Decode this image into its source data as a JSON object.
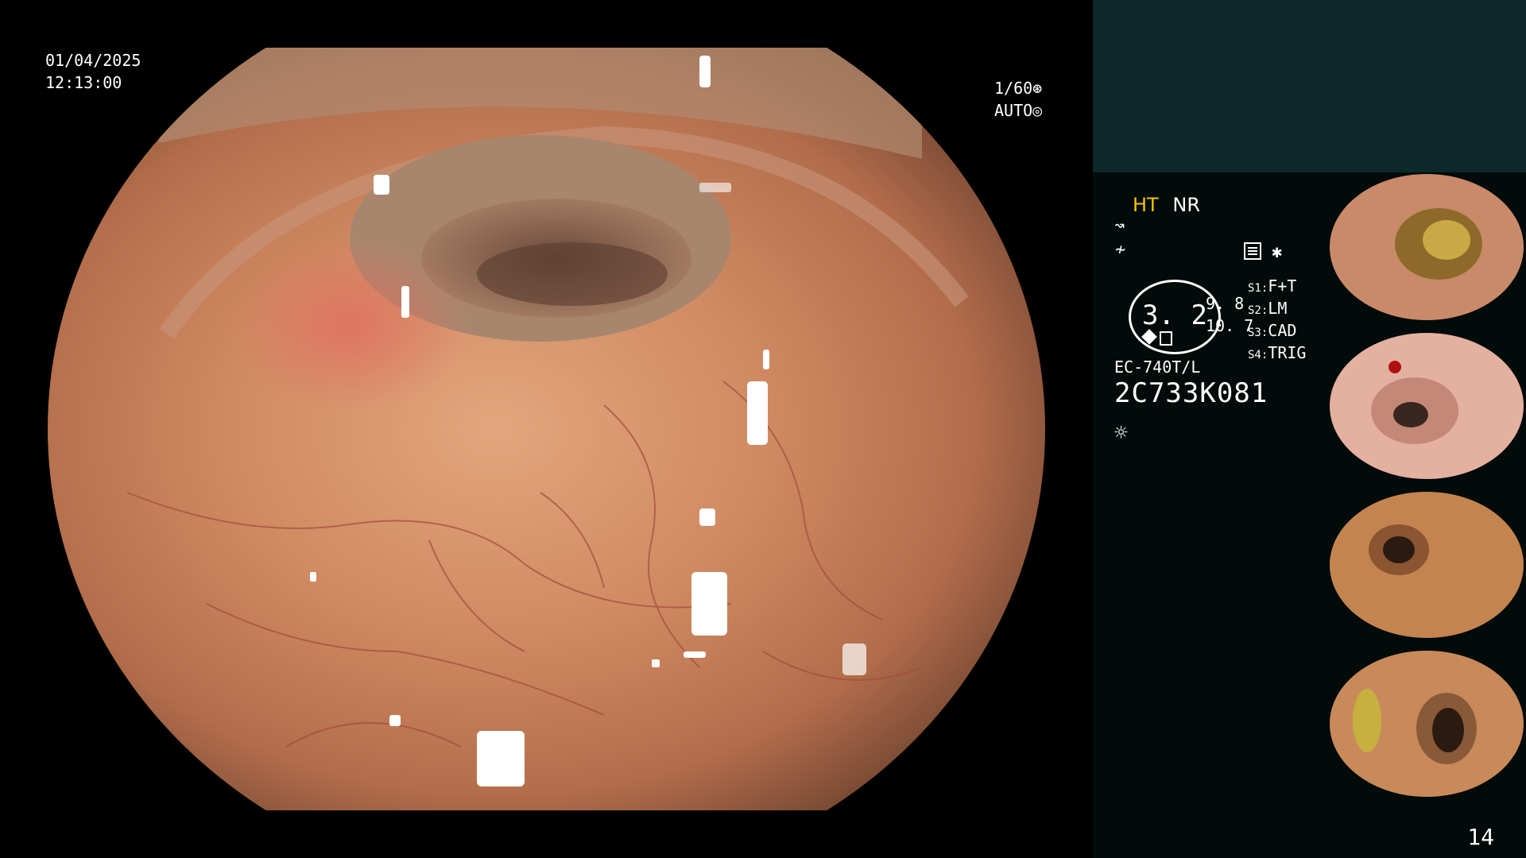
{
  "overlay": {
    "date": "01/04/2025",
    "time": "12:13:00",
    "shutter": "1/60",
    "exposure": "AUTO"
  },
  "panel": {
    "mode_ht": "HT",
    "mode_nr": "NR",
    "gauge_value": "3. 2",
    "side_value_1": "9. 8",
    "side_value_2": "10. 7",
    "model": "EC-740T/L",
    "serial": "2C733K081",
    "settings": [
      {
        "key": "S1:",
        "value": "F+T"
      },
      {
        "key": "S2:",
        "value": "LM"
      },
      {
        "key": "S3:",
        "value": "CAD"
      },
      {
        "key": "S4:",
        "value": "TRIG"
      }
    ],
    "page_number": "14"
  },
  "icons": {
    "shutter_icon": "aperture-icon",
    "auto_icon": "target-icon",
    "curve_icon": "curve-icon",
    "slash_icon": "signal-slash-icon",
    "menu_icon": "settings-menu-icon",
    "asterisk_icon": "asterisk-icon",
    "light_icon": "light-icon"
  },
  "colors": {
    "highlight": "#f5c400",
    "panel_top": "#0c2828",
    "panel_bg": "#020a0a"
  }
}
